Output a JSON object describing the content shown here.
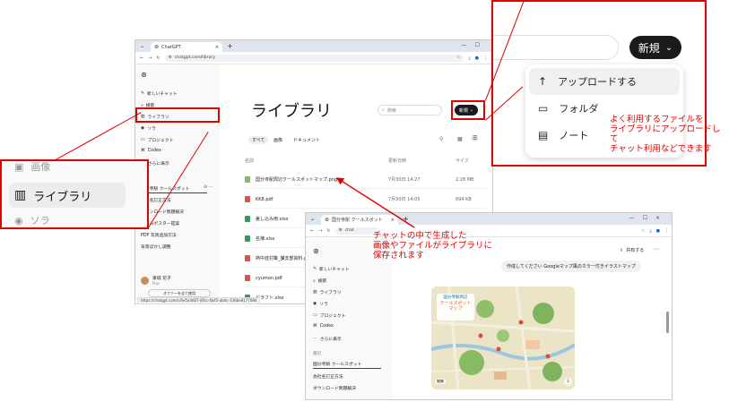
{
  "colors": {
    "annotation": "#e00000",
    "underline_blue": "#1e3ec8",
    "dark_button": "#1a1a1a"
  },
  "browser_main": {
    "tab_title": "ChatGPT",
    "url": "chatgpt.com/library",
    "status_url": "https://chatgpt.com/c/6e5a4d07-8f3c-4b45-ab4c-336be8177084"
  },
  "sidebar_main": {
    "items": [
      {
        "label": "新しいチャット",
        "icon": "edit-icon"
      },
      {
        "label": "検索",
        "icon": "search-icon"
      },
      {
        "label": "ライブラリ",
        "icon": "library-icon"
      },
      {
        "label": "ソラ",
        "icon": "sora-icon"
      },
      {
        "label": "プロジェクト",
        "icon": "folder-icon"
      },
      {
        "label": "Codex",
        "icon": "codex-icon"
      },
      {
        "label": "さらに表示",
        "icon": "more-icon"
      }
    ],
    "section_recent": "最近",
    "recent": [
      "国分寺駅 クールスポット",
      "会社名訂正方法",
      "ダウンロード問題解決",
      "事件みポスター提案",
      "PDF 写真追加方法",
      "背景ぼかし調整"
    ],
    "user_name": "東城 花子",
    "user_plan": "Plus",
    "upgrade_label": "オファーを全て使用"
  },
  "library": {
    "title": "ライブラリ",
    "search_placeholder": "検索",
    "new_label": "新規",
    "tabs": [
      "すべて",
      "画像",
      "ドキュメント"
    ],
    "columns": [
      "名前",
      "更新日時",
      "サイズ"
    ],
    "files": [
      {
        "name": "国分寺駅周辺クールスポットマップ.png",
        "date": "7月30日 14:27",
        "size": "2.28 MB",
        "icon": "image-file-icon",
        "color": "#8ab86a"
      },
      {
        "name": "KK8.pdf",
        "date": "7月30日 14:05",
        "size": "694 KB",
        "icon": "pdf-file-icon",
        "color": "#e2504a"
      },
      {
        "name": "差し込み用.xlsx",
        "date": "",
        "size": "10.6 KB",
        "icon": "excel-file-icon",
        "color": "#2e9b5a"
      },
      {
        "name": "名簿.xlsx",
        "date": "",
        "size": "",
        "icon": "excel-file-icon",
        "color": "#2e9b5a"
      },
      {
        "name": "熱中症対策_課支部資料.pdf",
        "date": "",
        "size": "",
        "icon": "pdf-file-icon",
        "color": "#e2504a"
      },
      {
        "name": "cyumon.pdf",
        "date": "",
        "size": "",
        "icon": "pdf-file-icon",
        "color": "#e2504a"
      },
      {
        "name": "ドラフト.xlsx",
        "date": "",
        "size": "",
        "icon": "excel-file-icon",
        "color": "#2e9b5a"
      }
    ]
  },
  "zoom_left": {
    "items": [
      "画像",
      "ライブラリ",
      "ソラ"
    ]
  },
  "zoom_right": {
    "new_label": "新規",
    "menu": [
      {
        "label": "アップロードする",
        "icon": "upload-icon"
      },
      {
        "label": "フォルダ",
        "icon": "folder-icon"
      },
      {
        "label": "ノート",
        "icon": "note-icon"
      }
    ]
  },
  "annotations": {
    "right_note": [
      "よく利用するファイルを",
      "ライブラリにアップロードして",
      "チャット利用などできます"
    ],
    "center_note": [
      "チャットの中で生成した",
      "画像やファイルがライブラリに",
      "保存されます"
    ]
  },
  "browser_chat": {
    "tab_title": "国分寺駅 クールスポット",
    "url": "chat",
    "share_label": "共有する",
    "user_message": "作成してください Googleマップ風のカラー付きイラストマップ",
    "map_title_line1": "国分寺駅周辺",
    "map_title_line2": "クールスポット",
    "map_title_line3": "マップ",
    "map_badge": "編集"
  }
}
